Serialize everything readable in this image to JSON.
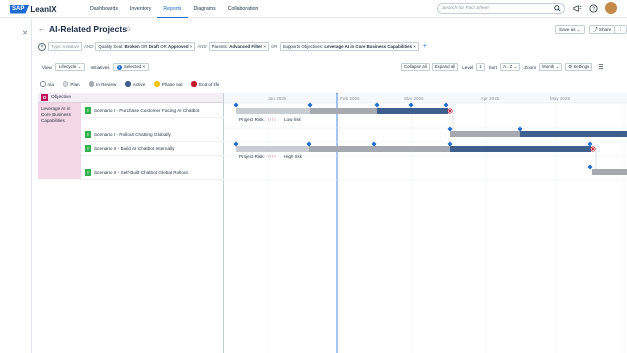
{
  "brand": {
    "sap": "SAP",
    "leanix": "LeanIX"
  },
  "nav": [
    {
      "label": "Dashboards",
      "name": "nav-dashboards",
      "active": false
    },
    {
      "label": "Inventory",
      "name": "nav-inventory",
      "active": false
    },
    {
      "label": "Reports",
      "name": "nav-reports",
      "active": true
    },
    {
      "label": "Diagrams",
      "name": "nav-diagrams",
      "active": false
    },
    {
      "label": "Collaboration",
      "name": "nav-collaboration",
      "active": false
    }
  ],
  "search": {
    "placeholder": "Search for Fact Sheet"
  },
  "header": {
    "title": "AI-Related Projects",
    "save_as": "Save as",
    "share": "Share",
    "more": "⋮"
  },
  "filters": {
    "type_label": "Type:",
    "type_value": "Initiative",
    "op_and1": "AND",
    "quality_label": "Quality Seal:",
    "quality_v1": "Broken",
    "quality_or1": "OR",
    "quality_v2": "Draft",
    "quality_or2": "OR",
    "quality_v3": "Approved",
    "op_and2": "AND",
    "parents_label": "Parents:",
    "parents_value": "Advanced Filter",
    "op_or": "OR",
    "supports_label": "Supports Objectives:",
    "supports_value": "Leverage AI in Core Business Capabilities"
  },
  "viewbar": {
    "view_label": "View",
    "view_value": "Lifecycle",
    "initiatives_label": "Initiatives",
    "selected_count": "1",
    "selected_label": "Selected",
    "collapse_all": "Collapse all",
    "expand_all": "Expand all",
    "level_label": "Level",
    "level_value": "1",
    "sort_label": "Sort",
    "sort_value": "A...Z",
    "zoom_label": "Zoom",
    "zoom_value": "Month",
    "settings": "Settings"
  },
  "legend": [
    {
      "label": "n/a",
      "color": "#ffffff",
      "border": "#8a94a3"
    },
    {
      "label": "Plan",
      "color": "#d7d9dd",
      "border": "#b8bcc4"
    },
    {
      "label": "In Review",
      "color": "#a6a9af",
      "border": "#a6a9af"
    },
    {
      "label": "Active",
      "color": "#3f5f8e",
      "border": "#3f5f8e"
    },
    {
      "label": "Phase out",
      "color": "#f5c518",
      "border": "#f5c518"
    },
    {
      "label": "End of life",
      "color": "#c0192c",
      "border": "#c0192c"
    }
  ],
  "tree": {
    "objective_header": "Objective",
    "objective_badge": "O",
    "objective_name": "Leverage AI in Core Business Capabilities",
    "initiative_badge": "I",
    "initiatives": [
      "Scenario I - Purchase Customer Facing AI Chatbot",
      "Scenario I - Rollout Chatting Globally",
      "Scenario II - Build AI Chatbot Internally",
      "Scenario II - Self-Built Chatbot Global Rollout"
    ]
  },
  "gantt": {
    "months": [
      "Jan 2025",
      "Feb 2025",
      "Mar 2025",
      "Apr 2025",
      "May 2025"
    ],
    "risk_label_1": "Project Risk:",
    "risk_arrows_1": "↑↑↑↑",
    "risk_value_1": "Low risk",
    "risk_label_2": "Project Risk:",
    "risk_arrows_2": "↑↑↑↑",
    "risk_value_2": "High risk"
  }
}
